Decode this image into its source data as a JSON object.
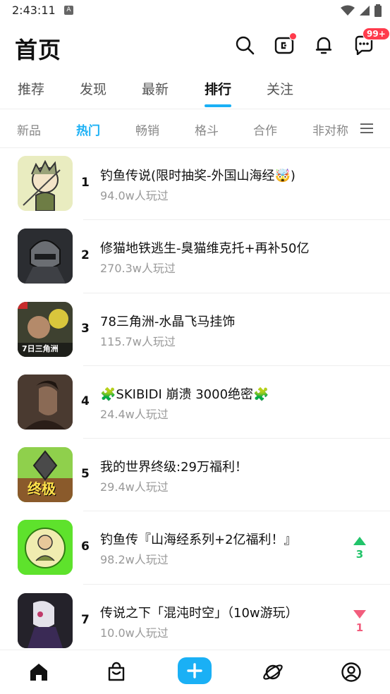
{
  "status": {
    "time": "2:43:11",
    "app_indicator": "A"
  },
  "header": {
    "title": "首页",
    "notification_badge": "99+"
  },
  "tabs": [
    {
      "label": "推荐"
    },
    {
      "label": "发现"
    },
    {
      "label": "最新"
    },
    {
      "label": "排行"
    },
    {
      "label": "关注"
    }
  ],
  "active_tab": "排行",
  "subtabs": [
    {
      "label": "新品"
    },
    {
      "label": "热门"
    },
    {
      "label": "畅销"
    },
    {
      "label": "格斗"
    },
    {
      "label": "合作"
    },
    {
      "label": "非对称"
    }
  ],
  "active_subtab": "热门",
  "games": [
    {
      "rank": "1",
      "title": "钓鱼传说(限时抽奖-外国山海经🤯)",
      "plays": "94.0w人玩过",
      "trend": null
    },
    {
      "rank": "2",
      "title": "修猫地铁逃生-臭猫维克托+再补50亿",
      "plays": "270.3w人玩过",
      "trend": null
    },
    {
      "rank": "3",
      "title": "78三角洲-水晶飞马挂饰",
      "plays": "115.7w人玩过",
      "trend": null
    },
    {
      "rank": "4",
      "title": "🧩SKIBIDI 崩溃 3000绝密🧩",
      "plays": "24.4w人玩过",
      "trend": null
    },
    {
      "rank": "5",
      "title": "我的世界终级:29万福利！",
      "plays": "29.4w人玩过",
      "trend": null
    },
    {
      "rank": "6",
      "title": "钓鱼传『山海经系列+2亿福利！』",
      "plays": "98.2w人玩过",
      "trend": {
        "dir": "up",
        "value": "3"
      }
    },
    {
      "rank": "7",
      "title": "传说之下「混沌时空」（10w游玩）",
      "plays": "10.0w人玩过",
      "trend": {
        "dir": "down",
        "value": "1"
      }
    }
  ],
  "thumb_labels": {
    "t3": "7日三角洲",
    "t5": "终极"
  },
  "colors": {
    "accent": "#1ab0f5",
    "up": "#22c46a",
    "down": "#f25d7d",
    "badge": "#ff3b4c"
  },
  "icons": {
    "header": [
      "search-icon",
      "wallet-icon",
      "bell-icon",
      "message-icon"
    ],
    "bottom_nav": [
      "home-icon",
      "shop-bag-icon",
      "plus-icon",
      "planet-icon",
      "profile-icon"
    ]
  }
}
